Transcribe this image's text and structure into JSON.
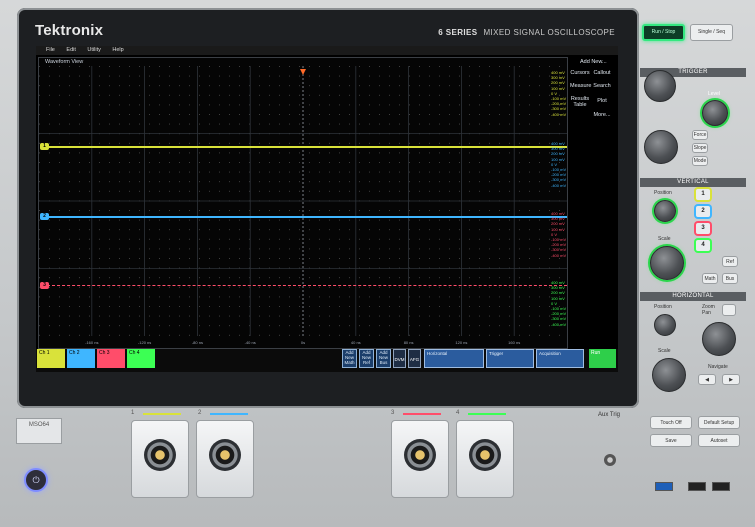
{
  "brand": "Tektronix",
  "series": {
    "num": "6 SERIES",
    "desc": "MIXED SIGNAL OSCILLOSCOPE"
  },
  "menu": [
    "File",
    "Edit",
    "Utility",
    "Help"
  ],
  "waveform_view": {
    "title": "Waveform View"
  },
  "time_ticks": [
    "-160 ns",
    "-120 ns",
    "-80 ns",
    "-40 ns",
    "0s",
    "40 ns",
    "80 ns",
    "120 ns",
    "160 ns"
  ],
  "channels": [
    {
      "id": "1",
      "color": "#d9e23a",
      "scale_labels": [
        "400 mV",
        "300 mV",
        "200 mV",
        "100 mV",
        "0 V",
        "-100 mV",
        "-200 mV",
        "-300 mV",
        "-400 mV"
      ]
    },
    {
      "id": "2",
      "color": "#3fb6ff",
      "scale_labels": [
        "400 mV",
        "300 mV",
        "200 mV",
        "100 mV",
        "0 V",
        "-100 mV",
        "-200 mV",
        "-300 mV",
        "-400 mV"
      ]
    },
    {
      "id": "3",
      "color": "#ff4d6a",
      "scale_labels": [
        "400 mV",
        "300 mV",
        "200 mV",
        "100 mV",
        "0 V",
        "-100 mV",
        "-200 mV",
        "-300 mV",
        "-400 mV"
      ]
    },
    {
      "id": "4",
      "color": "#3cff54",
      "scale_labels": [
        "400 mV",
        "300 mV",
        "200 mV",
        "100 mV",
        "0 V",
        "-100 mV",
        "-200 mV",
        "-300 mV",
        "-400 mV"
      ]
    }
  ],
  "side_panel": {
    "add_new": "Add New...",
    "cursors": "Cursors",
    "callout": "Callout",
    "measure": "Measure",
    "search": "Search",
    "results": "Results Table",
    "plot": "Plot",
    "more": "More..."
  },
  "bottom": {
    "ch1": "Ch 1",
    "ch2": "Ch 2",
    "ch3": "Ch 3",
    "ch4": "Ch 4",
    "add_math": "Add New Math",
    "add_ref": "Add New Ref",
    "add_bus": "Add New Bus",
    "dvm": "DVM",
    "afg": "AFG",
    "horizontal": "Horizontal",
    "trigger": "Trigger",
    "acquisition": "Acquisition",
    "run": "Run"
  },
  "controls": {
    "run_stop": "Run / Stop",
    "single_seq": "Single / Seq",
    "trigger": "TRIGGER",
    "level": "Level",
    "force": "Force",
    "slope": "Slope",
    "mode": "Mode",
    "vertical": "VERTICAL",
    "position": "Position",
    "scale": "Scale",
    "ch_buttons": [
      "1",
      "2",
      "3",
      "4"
    ],
    "ref": "Ref",
    "math": "Math",
    "bus": "Bus",
    "horizontal": "HORIZONTAL",
    "zoom": "Zoom",
    "pan": "Pan",
    "navigate": "Navigate",
    "touch_off": "Touch Off",
    "default_setup": "Default Setup",
    "save": "Save",
    "autoset": "Autoset"
  },
  "front": {
    "model": "MSO64",
    "aux_trig": "Aux Trig",
    "probe_labels": [
      "1",
      "2",
      "3",
      "4"
    ]
  }
}
